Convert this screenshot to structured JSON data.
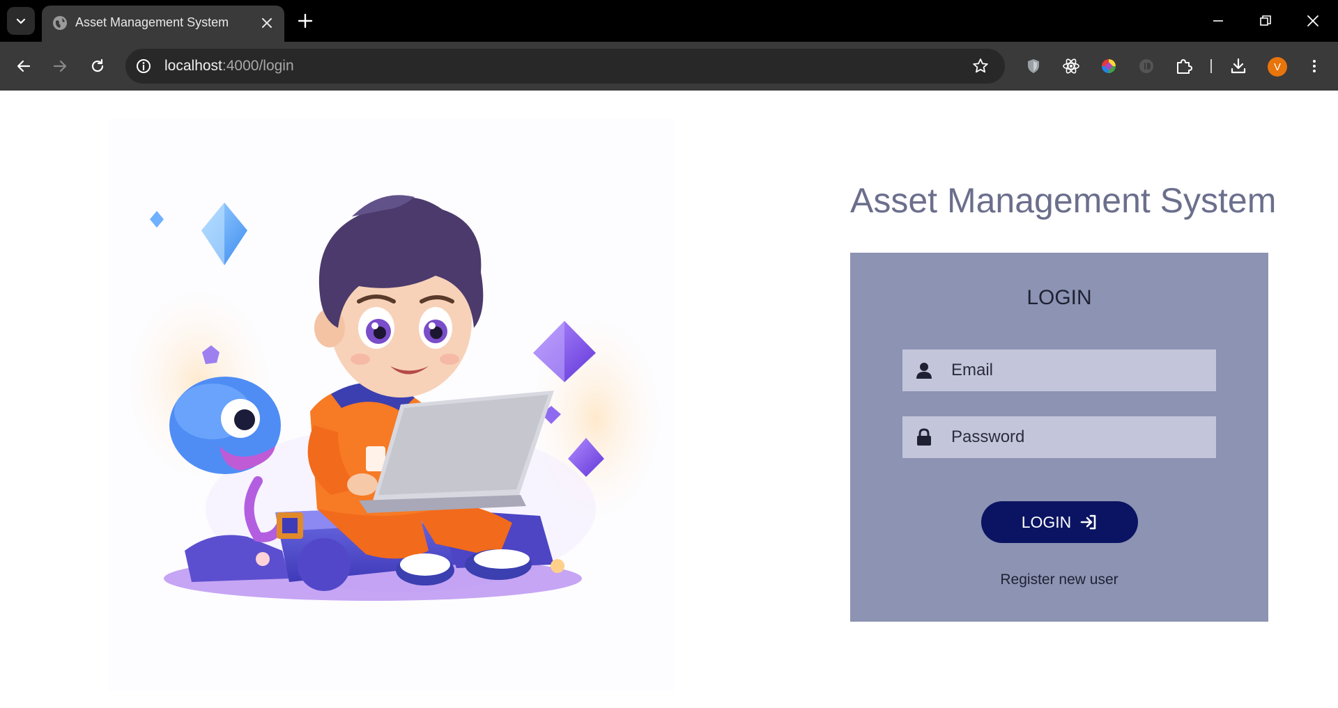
{
  "browser": {
    "tab_title": "Asset Management System",
    "url_host": "localhost",
    "url_path": ":4000/login",
    "profile_initial": "V",
    "profile_color": "#e8740c"
  },
  "page": {
    "app_title": "Asset Management System",
    "login_heading": "LOGIN",
    "email_placeholder": "Email",
    "password_placeholder": "Password",
    "login_button_label": "LOGIN",
    "register_link": "Register new user"
  },
  "colors": {
    "card_bg": "#8c93b3",
    "input_bg": "#c3c6db",
    "button_bg": "#0a1462",
    "title_color": "#6b6f8c"
  },
  "icons": {
    "email": "user-icon",
    "password": "lock-icon",
    "login_button": "sign-in-icon"
  }
}
